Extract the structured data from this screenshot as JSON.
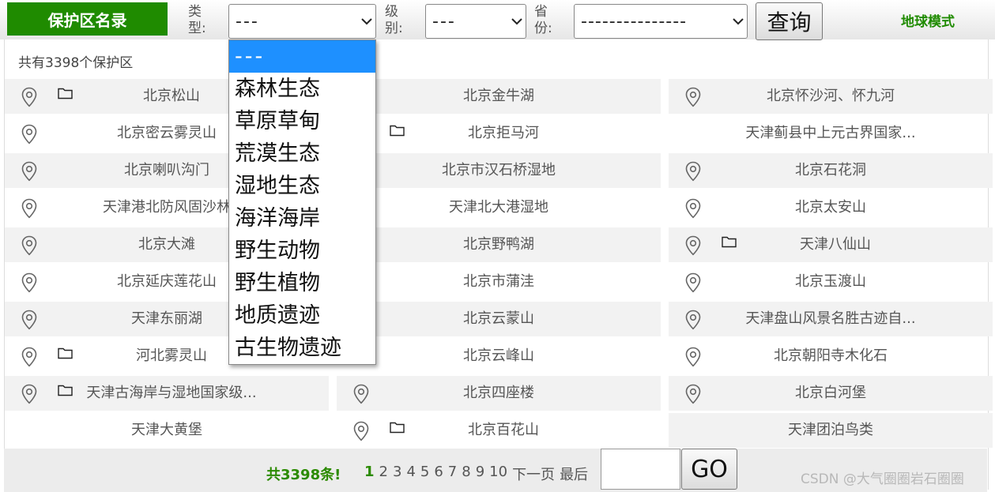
{
  "header": {
    "title": "保护区名录",
    "type_label": "类型:",
    "type_value": "---",
    "level_label": "级别:",
    "level_value": "---",
    "province_label": "省份:",
    "province_value": "---------------",
    "search_label": "查询",
    "earth_mode": "地球模式"
  },
  "count_text": "共有3398个保护区",
  "dropdown": {
    "options": [
      "---",
      "森林生态",
      "草原草甸",
      "荒漠生态",
      "湿地生态",
      "海洋海岸",
      "野生动物",
      "野生植物",
      "地质遗迹",
      "古生物遗迹"
    ],
    "selected": "---"
  },
  "reserves": [
    [
      "北京松山",
      "北京金牛湖",
      "北京怀沙河、怀九河"
    ],
    [
      "北京密云雾灵山",
      "北京拒马河",
      "天津蓟县中上元古界国家..."
    ],
    [
      "北京喇叭沟门",
      "北京市汉石桥湿地",
      "北京石花洞"
    ],
    [
      "天津港北防风固沙林",
      "天津北大港湿地",
      "北京太安山"
    ],
    [
      "北京大滩",
      "北京野鸭湖",
      "天津八仙山"
    ],
    [
      "北京延庆莲花山",
      "北京市蒲洼",
      "北京玉渡山"
    ],
    [
      "天津东丽湖",
      "北京云蒙山",
      "天津盘山风景名胜古迹自..."
    ],
    [
      "河北雾灵山",
      "北京云峰山",
      "北京朝阳寺木化石"
    ],
    [
      "天津古海岸与湿地国家级...",
      "北京四座楼",
      "北京白河堡"
    ],
    [
      "天津大黄堡",
      "北京百花山",
      "天津团泊鸟类"
    ]
  ],
  "pagination": {
    "total": "共3398条!",
    "pages": [
      "1",
      "2",
      "3",
      "4",
      "5",
      "6",
      "7",
      "8",
      "9",
      "10"
    ],
    "current": "1",
    "next": "下一页",
    "last": "最后",
    "go_label": "GO"
  },
  "watermark": "CSDN @大气圈圈岩石圈圈",
  "icons": {
    "location": "map-pin-icon",
    "folder": "folder-icon",
    "dropdown": "chevron-down-icon"
  },
  "colors": {
    "brand_green": "#1f8b00",
    "highlight_blue": "#1e90ff",
    "row_gray": "#f2f2f2"
  }
}
